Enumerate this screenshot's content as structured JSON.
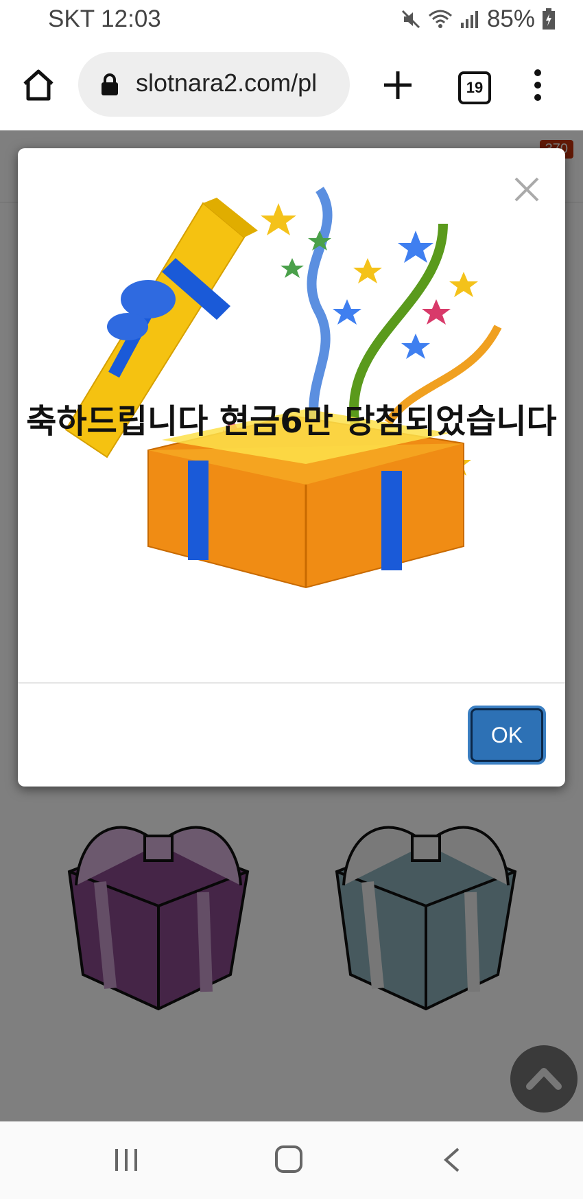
{
  "status_bar": {
    "carrier_time": "SKT 12:03",
    "battery": "85%",
    "icons": [
      "mute-icon",
      "wifi-icon",
      "signal-icon",
      "battery-icon"
    ]
  },
  "browser": {
    "url": "slotnara2.com/pl",
    "tab_count": "19",
    "icons": [
      "home-icon",
      "lock-icon",
      "plus-icon",
      "tabs-icon",
      "more-icon"
    ]
  },
  "page": {
    "header_badge": "370"
  },
  "modal": {
    "message": "축하드립니다 현금6만 당첨되었습니다",
    "ok_label": "OK",
    "close_icon": "close-icon",
    "image_icon": "gift-box-celebration-icon"
  },
  "nav": {
    "icons": [
      "recent-apps-icon",
      "home-nav-icon",
      "back-icon"
    ]
  },
  "colors": {
    "ok_button": "#2d71b5",
    "overlay": "#808080",
    "gift_left": "#5a2a5c",
    "gift_right": "#5e7070"
  }
}
